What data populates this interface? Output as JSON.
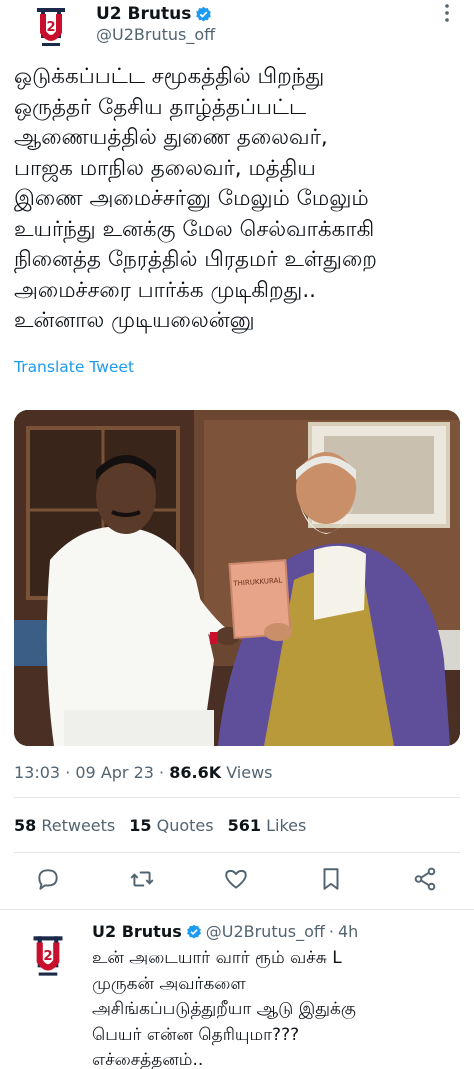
{
  "tweet": {
    "author": {
      "display_name": "U2 Brutus",
      "handle": "@U2Brutus_off",
      "avatar_icon": "u2-logo-avatar",
      "verified_icon": "verified-badge-icon"
    },
    "text_lines": [
      "ஒடுக்கப்பட்ட சமூகத்தில் பிறந்து",
      "ஒருத்தர் தேசிய தாழ்த்தப்பட்ட",
      "ஆணையத்தில் துணை தலைவர்,",
      "பாஜக மாநில தலைவர், மத்திய",
      "இணை அமைச்சர்னு  மேலும் மேலும்",
      "உயர்ந்து உனக்கு மேல செல்வாக்காகி",
      "நினைத்த நேரத்தில் பிரதமர் உள்துறை",
      "அமைச்சரை பார்க்க முடிகிறது..",
      "உன்னால முடியலைன்னு"
    ],
    "translate_label": "Translate Tweet",
    "image_book_title": "THIRUKKURAL",
    "time": "13:03",
    "date": "09 Apr 23",
    "views_count": "86.6K",
    "views_label": "Views",
    "retweets_count": "58",
    "retweets_label": "Retweets",
    "quotes_count": "15",
    "quotes_label": "Quotes",
    "likes_count": "561",
    "likes_label": "Likes",
    "actions": [
      "reply-icon",
      "retweet-icon",
      "like-icon",
      "bookmark-icon",
      "share-icon"
    ]
  },
  "reply": {
    "display_name": "U2 Brutus",
    "handle": "@U2Brutus_off",
    "age": "4h",
    "text_lines": [
      "உன் அடையார் வார் ரூம் வச்சு L",
      "முருகன் அவர்களை",
      "அசிங்கப்படுத்துறீயா ஆடு இதுக்கு",
      "பெயர் என்ன தெரியுமா???",
      "எச்சைத்தனம்.."
    ]
  },
  "colors": {
    "link": "#1d9bf0",
    "secondary_text": "#536471",
    "verified": "#1d9bf0",
    "avatar_red": "#c8102e",
    "avatar_navy": "#1b2a4a"
  }
}
